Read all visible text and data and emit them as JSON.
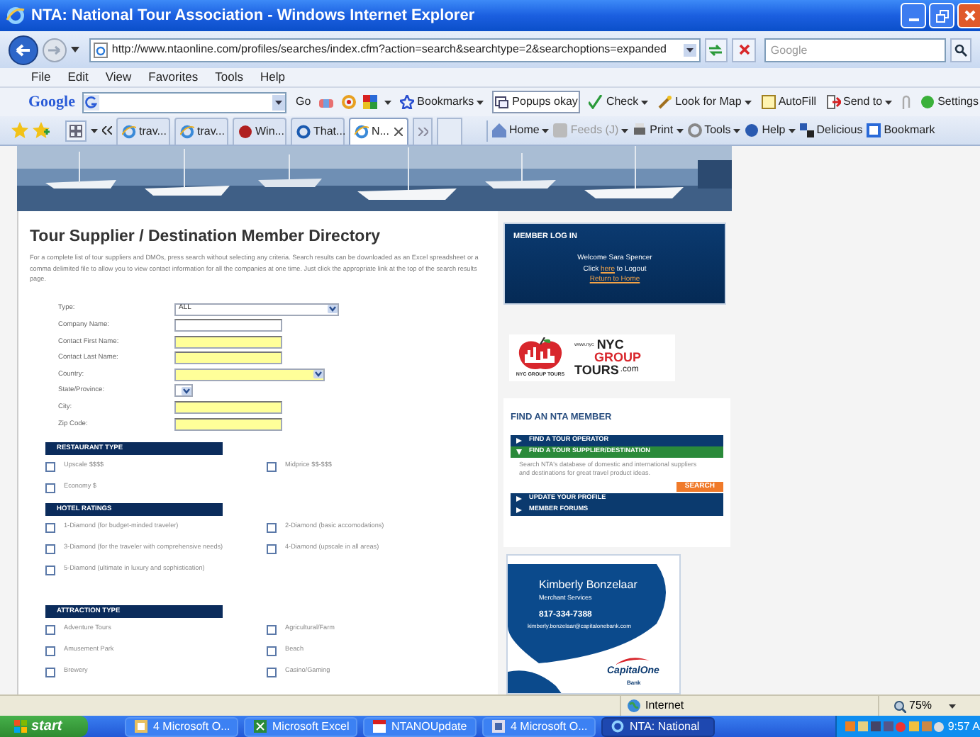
{
  "window": {
    "title": "NTA: National Tour Association - Windows Internet Explorer"
  },
  "address_bar": {
    "url": "http://www.ntaonline.com/profiles/searches/index.cfm?action=search&searchtype=2&searchoptions=expanded"
  },
  "search_box": {
    "placeholder": "Google"
  },
  "menu": [
    "File",
    "Edit",
    "View",
    "Favorites",
    "Tools",
    "Help"
  ],
  "google_toolbar": {
    "logo": "Google",
    "items": [
      {
        "label": "Go",
        "dropdown": false
      },
      {
        "label": "Bookmarks",
        "dropdown": true
      },
      {
        "label": "Popups okay",
        "dropdown": false
      },
      {
        "label": "Check",
        "dropdown": true
      },
      {
        "label": "Look for Map",
        "dropdown": true
      },
      {
        "label": "AutoFill",
        "dropdown": false
      },
      {
        "label": "Send to",
        "dropdown": true
      },
      {
        "label": "Settings",
        "dropdown": false
      }
    ]
  },
  "tabs": [
    {
      "label": "trav...",
      "selected": false
    },
    {
      "label": "trav...",
      "selected": false
    },
    {
      "label": "Win...",
      "selected": false
    },
    {
      "label": "That...",
      "selected": false
    },
    {
      "label": "N...",
      "selected": true
    }
  ],
  "command_bar": [
    {
      "label": "Home",
      "dropdown": true,
      "disabled": false
    },
    {
      "label": "Feeds (J)",
      "dropdown": true,
      "disabled": true
    },
    {
      "label": "Print",
      "dropdown": true,
      "disabled": false
    },
    {
      "label": "Tools",
      "dropdown": true,
      "disabled": false
    },
    {
      "label": "Help",
      "dropdown": true,
      "disabled": false
    },
    {
      "label": "Delicious",
      "dropdown": false,
      "disabled": false
    },
    {
      "label": "Bookmark",
      "dropdown": false,
      "disabled": false
    }
  ],
  "page": {
    "title": "Tour Supplier / Destination Member Directory",
    "intro": "For a complete list of tour suppliers and DMOs, press search without selecting any criteria. Search results can be downloaded as an Excel spreadsheet or a comma delimited file to allow you to view contact information for all the companies at one time. Just click the appropriate link at the top of the search results page.",
    "form": [
      {
        "label": "Type:",
        "kind": "select",
        "value": "ALL",
        "highlighted": false
      },
      {
        "label": "Company Name:",
        "kind": "text",
        "highlighted": false
      },
      {
        "label": "Contact First Name:",
        "kind": "text",
        "highlighted": true
      },
      {
        "label": "Contact Last Name:",
        "kind": "text",
        "highlighted": true
      },
      {
        "label": "Country:",
        "kind": "select",
        "highlighted": true
      },
      {
        "label": "State/Province:",
        "kind": "select",
        "highlighted": false
      },
      {
        "label": "City:",
        "kind": "text",
        "highlighted": true
      },
      {
        "label": "Zip Code:",
        "kind": "text",
        "highlighted": true
      }
    ],
    "sections": [
      {
        "title": "RESTAURANT TYPE",
        "options": [
          {
            "label": "Upscale $$$$",
            "checked": false
          },
          {
            "label": "Midprice $$-$$$",
            "checked": false
          },
          {
            "label": "Economy $",
            "checked": false
          }
        ]
      },
      {
        "title": "HOTEL RATINGS",
        "options": [
          {
            "label": "1-Diamond (for budget-minded traveler)",
            "checked": false
          },
          {
            "label": "2-Diamond (basic accomodations)",
            "checked": false
          },
          {
            "label": "3-Diamond (for the traveler with comprehensive needs)",
            "checked": false
          },
          {
            "label": "4-Diamond (upscale in all areas)",
            "checked": false
          },
          {
            "label": "5-Diamond (ultimate in luxury and sophistication)",
            "checked": false
          }
        ]
      },
      {
        "title": "ATTRACTION TYPE",
        "options": [
          {
            "label": "Adventure Tours",
            "checked": false
          },
          {
            "label": "Agricultural/Farm",
            "checked": false
          },
          {
            "label": "Amusement Park",
            "checked": false
          },
          {
            "label": "Beach",
            "checked": false
          },
          {
            "label": "Brewery",
            "checked": false
          },
          {
            "label": "Casino/Gaming",
            "checked": false
          }
        ]
      }
    ]
  },
  "sidebar": {
    "login": {
      "title": "MEMBER LOG IN",
      "welcome": "Welcome Sara Spencer",
      "logout_prefix": "Click",
      "logout_link": "here",
      "logout_suffix": "to Logout",
      "home_link": "Return to Home"
    },
    "ad": {
      "url": "www.nyc",
      "line1": "NYC",
      "line2": "GROUP",
      "line3": "TOURS",
      "suffix": ".com",
      "caption": "NYC GROUP TOURS"
    },
    "find_member": {
      "title": "FIND AN NTA MEMBER",
      "items": [
        {
          "label": "FIND A TOUR OPERATOR",
          "expanded": false
        },
        {
          "label": "FIND A TOUR SUPPLIER/DESTINATION",
          "expanded": true,
          "description": "Search NTA's database of domestic and international suppliers and destinations for great travel product ideas.",
          "button": "SEARCH"
        },
        {
          "label": "UPDATE YOUR PROFILE",
          "expanded": false
        },
        {
          "label": "MEMBER FORUMS",
          "expanded": false
        }
      ]
    },
    "card": {
      "name": "Kimberly Bonzelaar",
      "role": "Merchant Services",
      "phone": "817-334-7388",
      "email": "kimberly.bonzelaar@capitalonebank.com",
      "logo": "CapitalOne",
      "logo_sub": "Bank"
    }
  },
  "status_bar": {
    "zone": "Internet",
    "zoom": "75%"
  },
  "taskbar": {
    "start": "start",
    "items": [
      {
        "label": "4 Microsoft O...",
        "selected": false
      },
      {
        "label": "Microsoft Excel",
        "selected": false
      },
      {
        "label": "NTANOUpdate",
        "selected": false
      },
      {
        "label": "4 Microsoft O...",
        "selected": false
      },
      {
        "label": "NTA: National",
        "selected": true
      }
    ],
    "clock": "9:57 A"
  }
}
